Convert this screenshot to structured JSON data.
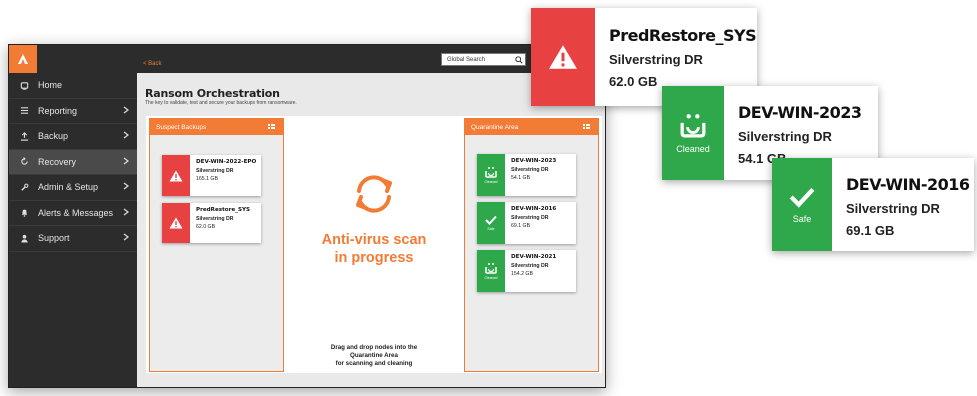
{
  "app": {
    "back_label": "< Back",
    "search_placeholder": "Global Search",
    "page_title": "Ransom Orchestration",
    "page_subtitle": "The key to validate, test and secure your backups from ransomware."
  },
  "sidebar": {
    "items": [
      {
        "label": "Home",
        "icon": "home-icon",
        "chevron": false,
        "active": false
      },
      {
        "label": "Reporting",
        "icon": "list-icon",
        "chevron": true,
        "active": false
      },
      {
        "label": "Backup",
        "icon": "upload-icon",
        "chevron": true,
        "active": false
      },
      {
        "label": "Recovery",
        "icon": "refresh-icon",
        "chevron": true,
        "active": true
      },
      {
        "label": "Admin & Setup",
        "icon": "wrench-icon",
        "chevron": true,
        "active": false
      },
      {
        "label": "Alerts & Messages",
        "icon": "bell-icon",
        "chevron": true,
        "active": false
      },
      {
        "label": "Support",
        "icon": "person-icon",
        "chevron": true,
        "active": false
      }
    ]
  },
  "suspect_panel": {
    "title": "Suspect Backups",
    "nodes": [
      {
        "name": "DEV-WIN-2022-EPO",
        "sub": "Silverstring DR",
        "size": "165.1 GB",
        "status": "warning"
      },
      {
        "name": "PredRestore_SYS",
        "sub": "Silverstring DR",
        "size": "62.0 GB",
        "status": "warning"
      }
    ]
  },
  "quarantine_panel": {
    "title": "Quarantine Area",
    "nodes": [
      {
        "name": "DEV-WIN-2023",
        "sub": "Silverstring DR",
        "size": "54.1 GB",
        "status": "Cleaned"
      },
      {
        "name": "DEV-WIN-2016",
        "sub": "Silverstring DR",
        "size": "69.1 GB",
        "status": "Safe"
      },
      {
        "name": "DEV-WIN-2021",
        "sub": "Silverstring DR",
        "size": "154.2 GB",
        "status": "Cleaned"
      }
    ]
  },
  "center": {
    "scan_line1": "Anti-virus scan",
    "scan_line2": "in progress",
    "drag_line1": "Drag and drop nodes into the",
    "drag_line2": "Quarantine Area",
    "drag_line3": "for scanning and cleaning"
  },
  "callouts": [
    {
      "name": "PredRestore_SYS",
      "sub": "Silverstring DR",
      "size": "62.0 GB",
      "status": ""
    },
    {
      "name": "DEV-WIN-2023",
      "sub": "Silverstring DR",
      "size": "54.1 GB",
      "status": "Cleaned"
    },
    {
      "name": "DEV-WIN-2016",
      "sub": "Silverstring DR",
      "size": "69.1 GB",
      "status": "Safe"
    }
  ],
  "colors": {
    "accent": "#f27b35",
    "danger": "#e84142",
    "success": "#2ea84b",
    "sidebar": "#2c2c2c"
  }
}
